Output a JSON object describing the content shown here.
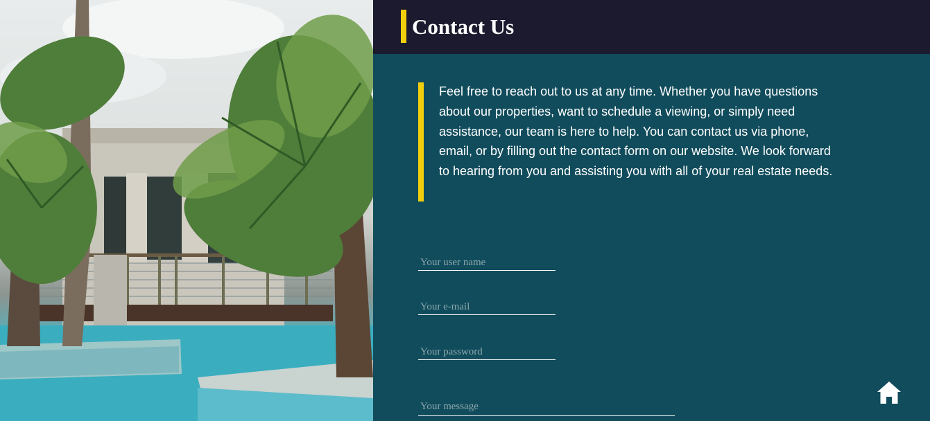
{
  "header": {
    "title": "Contact Us"
  },
  "intro": {
    "text": "Feel free to reach out to us at any time. Whether you have questions about our properties, want to schedule a viewing, or simply need assistance, our team is here to help. You can contact us via phone, email, or by filling out the contact form on our website. We look forward to hearing from you and assisting you with all of your real estate needs."
  },
  "form": {
    "username_placeholder": "Your user name",
    "email_placeholder": "Your e-mail",
    "password_placeholder": "Your password",
    "message_placeholder": "Your message"
  },
  "icons": {
    "home": "home-icon"
  },
  "colors": {
    "accent": "#f2cf0c",
    "header_bg": "#1b1a2e",
    "panel_bg": "#114c5c"
  }
}
